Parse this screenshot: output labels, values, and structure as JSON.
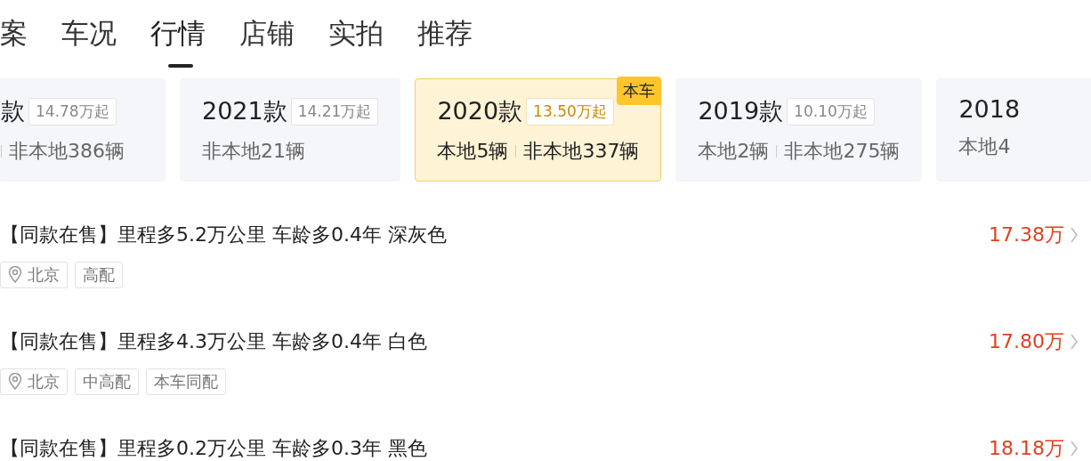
{
  "tabs": [
    {
      "label": "案",
      "selected": false
    },
    {
      "label": "车况",
      "selected": false
    },
    {
      "label": "行情",
      "selected": true
    },
    {
      "label": "店铺",
      "selected": false
    },
    {
      "label": "实拍",
      "selected": false
    },
    {
      "label": "推荐",
      "selected": false
    }
  ],
  "model_years": [
    {
      "year": "款",
      "price": "14.78万起",
      "stats": [
        "非本地386辆"
      ],
      "current": false
    },
    {
      "year": "2021款",
      "price": "14.21万起",
      "stats": [
        "非本地21辆"
      ],
      "current": false
    },
    {
      "year": "2020款",
      "price": "13.50万起",
      "stats": [
        "本地5辆",
        "非本地337辆"
      ],
      "current": true,
      "badge": "本车"
    },
    {
      "year": "2019款",
      "price": "10.10万起",
      "stats": [
        "本地2辆",
        "非本地275辆"
      ],
      "current": false
    },
    {
      "year": "2018",
      "stats": [
        "本地4"
      ],
      "current": false
    }
  ],
  "listings": [
    {
      "title": "【同款在售】里程多5.2万公里 车龄多0.4年 深灰色",
      "price": "17.38万",
      "location": "北京",
      "tags": [
        "高配"
      ]
    },
    {
      "title": "【同款在售】里程多4.3万公里 车龄多0.4年 白色",
      "price": "17.80万",
      "location": "北京",
      "tags": [
        "中高配",
        "本车同配"
      ]
    },
    {
      "title": "【同款在售】里程多0.2万公里 车龄多0.3年 黑色",
      "price": "18.18万"
    }
  ]
}
